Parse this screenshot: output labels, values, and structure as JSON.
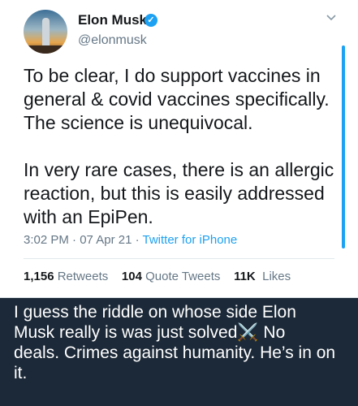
{
  "tweet": {
    "author_name": "Elon Musk",
    "handle": "@elonmusk",
    "verified_icon": "verified-badge-icon",
    "menu_icon": "chevron-down-icon",
    "text": "To be clear, I do support vaccines in\ngeneral & covid vaccines specifically.\nThe science is unequivocal.\n\nIn very rare cases, there is an allergic\nreaction, but this is easily addressed\nwith an EpiPen.",
    "time": "3:02 PM",
    "date": "07 Apr 21",
    "source": "Twitter for iPhone",
    "retweets_count": "1,156",
    "retweets_label": "Retweets",
    "quote_count": "104",
    "quote_label": "Quote Tweets",
    "likes_count": "11K",
    "likes_label": "Likes"
  },
  "caption": {
    "text": "I guess the riddle on whose side Elon\nMusk really is was just solved⚔️ No\ndeals. Crimes against humanity. He’s in on\nit."
  },
  "colors": {
    "page_bg": "#1c2938",
    "card_bg": "#ffffff",
    "accent": "#1da1f2",
    "muted": "#657786"
  }
}
